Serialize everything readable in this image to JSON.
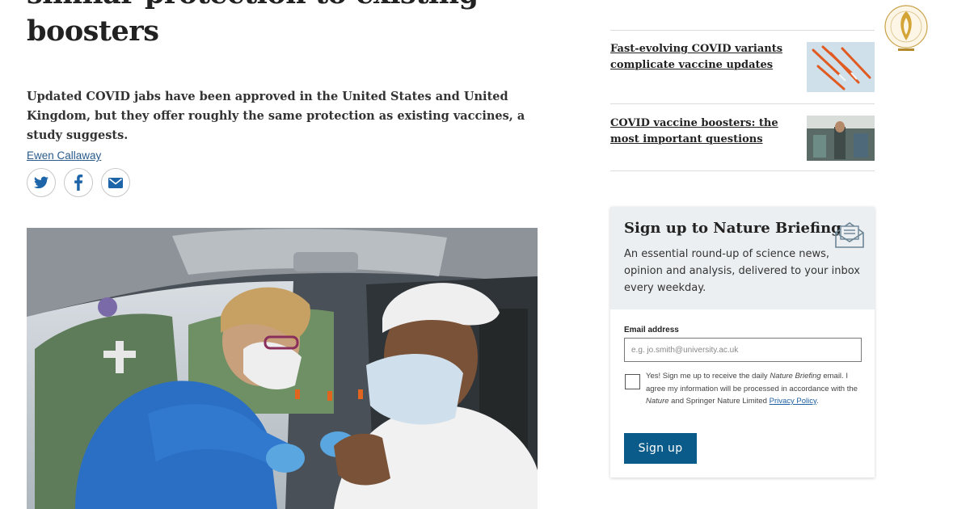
{
  "article": {
    "headline_line1": "similar protection to existing",
    "headline_line2": "boosters",
    "standfirst": "Updated COVID jabs have been approved in the United States and United Kingdom, but they offer roughly the same protection as existing vaccines, a study suggests.",
    "author": "Ewen Callaway",
    "share": [
      {
        "icon": "twitter-icon",
        "color": "#1d65a8"
      },
      {
        "icon": "facebook-icon",
        "color": "#1d65a8"
      },
      {
        "icon": "email-icon",
        "color": "#1d65a8"
      }
    ]
  },
  "related": [
    {
      "title": "Fast-evolving COVID variants complicate vaccine updates",
      "thumb": "syringes-photo"
    },
    {
      "title": "COVID vaccine boosters: the most important questions",
      "thumb": "clinic-photo"
    }
  ],
  "newsletter": {
    "title": "Sign up to Nature Briefing",
    "description": "An essential round-up of science news, opinion and analysis, delivered to your inbox every weekday.",
    "email_label": "Email address",
    "email_placeholder": "e.g. jo.smith@university.ac.uk",
    "consent_1": "Yes! Sign me up to receive the daily ",
    "consent_brand": "Nature Briefing",
    "consent_2": " email. I agree my information will be processed in accordance with the ",
    "consent_nature": "Nature",
    "consent_3": " and Springer Nature Limited ",
    "consent_link": "Privacy Policy",
    "consent_4": ".",
    "submit_label": "Sign up"
  },
  "colors": {
    "link": "#2a5b8c",
    "button": "#0a5a8a",
    "box_header": "#eceff1"
  }
}
